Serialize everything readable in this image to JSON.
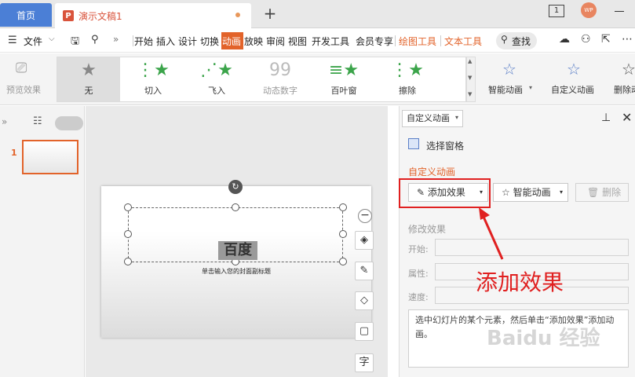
{
  "tabs": {
    "home": "首页",
    "doc": "演示文稿1",
    "new": "+"
  },
  "window": {
    "number": "1",
    "avatar": "WP"
  },
  "menu": {
    "file": "文件",
    "items": [
      "开始",
      "插入",
      "设计",
      "切换",
      "动画",
      "放映",
      "审阅",
      "视图",
      "开发工具",
      "会员专享",
      "绘图工具",
      "文本工具"
    ],
    "search": "查找"
  },
  "ribbon": {
    "preview": "预览效果",
    "animations": [
      "无",
      "切入",
      "飞入",
      "动态数字",
      "百叶窗",
      "擦除"
    ],
    "smart_anim": "智能动画",
    "custom_anim": "自定义动画",
    "delete_anim": "删除动"
  },
  "thumbnails": {
    "slide_number": "1"
  },
  "slide": {
    "title": "百度",
    "subtitle": "单击输入您的封面副标题"
  },
  "float_tools": [
    "字"
  ],
  "pane": {
    "header": "自定义动画",
    "selection_pane": "选择窗格",
    "section_title": "自定义动画",
    "add_effect": "添加效果",
    "smart_anim": "智能动画",
    "delete": "删除",
    "modify_title": "修改效果",
    "start_label": "开始:",
    "property_label": "属性:",
    "speed_label": "速度:",
    "hint": "选中幻灯片的某个元素，然后单击“添加效果”添加动画。"
  },
  "annotation": "添加效果",
  "watermark": "Baidu 经验"
}
